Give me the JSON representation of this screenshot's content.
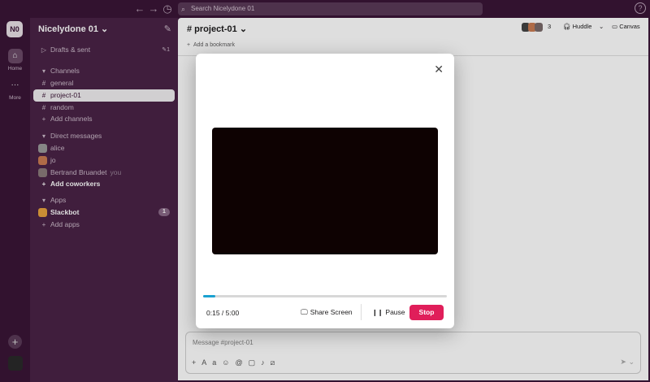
{
  "search": {
    "placeholder": "Search Nicelydone 01"
  },
  "rail": {
    "workspace_initials": "N0",
    "items": [
      {
        "label": "Home"
      },
      {
        "label": "More"
      }
    ]
  },
  "sidebar": {
    "workspace_name": "Nicelydone 01",
    "drafts": {
      "label": "Drafts & sent",
      "count": "1"
    },
    "channels_header": "Channels",
    "channels": [
      {
        "label": "general"
      },
      {
        "label": "project-01"
      },
      {
        "label": "random"
      }
    ],
    "add_channels": "Add channels",
    "dm_header": "Direct messages",
    "dms": [
      {
        "label": "alice"
      },
      {
        "label": "jo"
      },
      {
        "label": "Bertrand Bruandet",
        "suffix": "you"
      }
    ],
    "add_coworkers": "Add coworkers",
    "apps_header": "Apps",
    "apps": [
      {
        "label": "Slackbot",
        "badge": "1"
      }
    ],
    "add_apps": "Add apps"
  },
  "channel": {
    "title": "# project-01",
    "bookmark": "Add a bookmark",
    "member_count": "3",
    "huddle_label": "Huddle",
    "canvas_label": "Canvas"
  },
  "composer": {
    "placeholder": "Message #project-01"
  },
  "recording": {
    "elapsed": "0:15",
    "limit": "5:00",
    "progress": 0.05,
    "share_label": "Share Screen",
    "pause_label": "Pause",
    "stop_label": "Stop"
  },
  "colors": {
    "stop": "#e01e5a",
    "progress": "#1aa1d1",
    "sidebar": "#4a2347"
  }
}
